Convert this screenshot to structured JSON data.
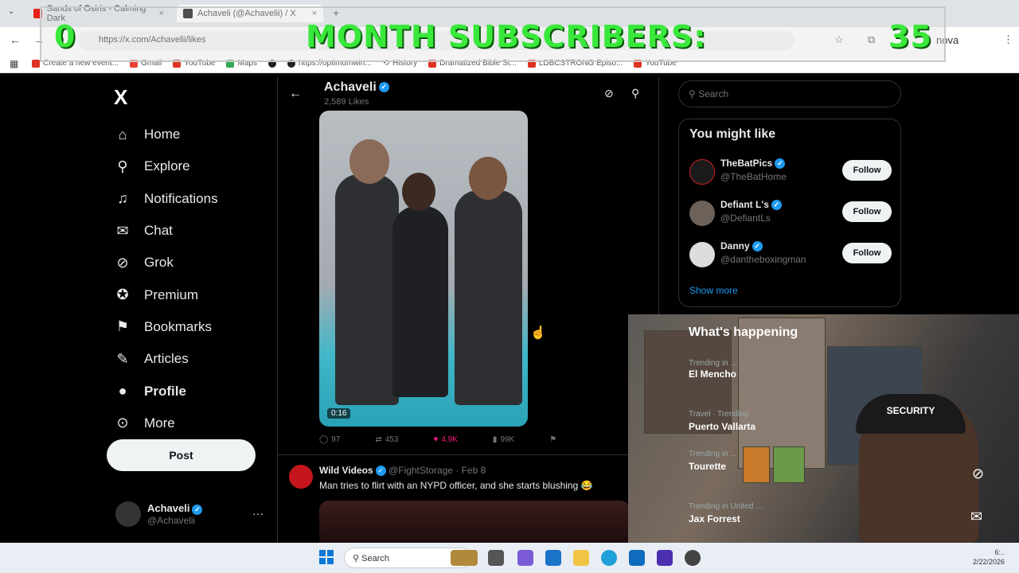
{
  "browser": {
    "tabs": [
      {
        "title": "Sands of Osiris - Calming Dark",
        "close": "×"
      },
      {
        "title": "Achaveli (@Achavelii) / X",
        "close": "×"
      }
    ],
    "new_tab": "+",
    "url": "https://x.com/Achavelii/likes",
    "profile_label": "nova",
    "bookmarks": [
      "Create a new event...",
      "Gmail",
      "YouTube",
      "Maps",
      "",
      "https://optimumwin...",
      "History",
      "Dramatized Bible St...",
      "LDBCSTRONG Episo...",
      "YouTube"
    ]
  },
  "overlay": {
    "left_count": "0",
    "label": "MONTH SUBSCRIBERS:",
    "right_count": "35"
  },
  "sidebar": {
    "logo": "X",
    "items": [
      {
        "label": "Home",
        "icon": "home-icon"
      },
      {
        "label": "Explore",
        "icon": "search-icon"
      },
      {
        "label": "Notifications",
        "icon": "bell-icon"
      },
      {
        "label": "Chat",
        "icon": "mail-icon"
      },
      {
        "label": "Grok",
        "icon": "grok-icon"
      },
      {
        "label": "Premium",
        "icon": "premium-icon"
      },
      {
        "label": "Bookmarks",
        "icon": "bookmark-icon"
      },
      {
        "label": "Articles",
        "icon": "articles-icon"
      },
      {
        "label": "Profile",
        "icon": "person-icon"
      },
      {
        "label": "More",
        "icon": "more-icon"
      }
    ],
    "post_label": "Post",
    "account": {
      "name": "Achaveli",
      "handle": "@Achavelii",
      "more": "···"
    }
  },
  "header": {
    "title": "Achaveli",
    "subtitle": "2,589 Likes"
  },
  "tweet1": {
    "duration": "0:16",
    "replies": "97",
    "reposts": "453",
    "likes": "4.9K",
    "views": "99K"
  },
  "tweet2": {
    "name": "Wild Videos",
    "handle": "@FightStorage",
    "date": "· Feb 8",
    "text": "Man tries to flirt with an NYPD officer, and she starts blushing 😂"
  },
  "right": {
    "search_placeholder": "Search",
    "might_like_title": "You might like",
    "suggestions": [
      {
        "name": "TheBatPics",
        "handle": "@TheBatHome",
        "follow": "Follow"
      },
      {
        "name": "Defiant L's",
        "handle": "@DefiantLs",
        "follow": "Follow"
      },
      {
        "name": "Danny",
        "handle": "@dantheboxingman",
        "follow": "Follow"
      }
    ],
    "show_more": "Show more",
    "happening_title": "What's happening",
    "trends": [
      {
        "context": "Trending in ...",
        "name": "El Mencho"
      },
      {
        "context": "Travel · Trending",
        "name": "Puerto Vallarta"
      },
      {
        "context": "Trending in ...",
        "name": "Tourette"
      },
      {
        "context": "Trending in United ...",
        "name": "Jax Forrest"
      }
    ],
    "cam_cap_text": "SECURITY"
  },
  "taskbar": {
    "search": "Search",
    "time": "6:..",
    "date": "2/22/2026"
  },
  "colors": {
    "accent": "#1d9bf0",
    "like": "#f91880",
    "overlay_text": "#39e83a"
  }
}
